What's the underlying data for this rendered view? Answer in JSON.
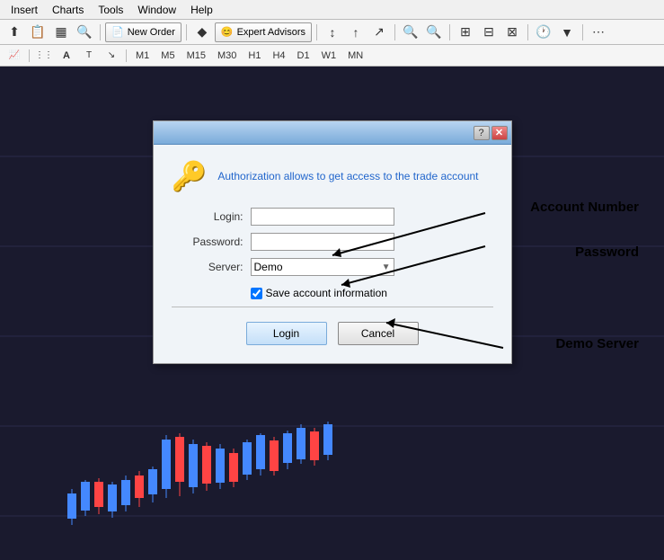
{
  "menubar": {
    "items": [
      "Insert",
      "Charts",
      "Tools",
      "Window",
      "Help"
    ]
  },
  "toolbar": {
    "new_order_label": "New Order",
    "expert_advisors_label": "Expert Advisors"
  },
  "timeframes": {
    "buttons": [
      "M1",
      "M5",
      "M15",
      "M30",
      "H1",
      "H4",
      "D1",
      "W1",
      "MN"
    ]
  },
  "dialog": {
    "title": "",
    "help_btn": "?",
    "close_btn": "✕",
    "description": "Authorization allows to get access to the trade account",
    "login_label": "Login:",
    "password_label": "Password:",
    "server_label": "Server:",
    "server_value": "Demo",
    "save_info_label": "Save account information",
    "login_btn": "Login",
    "cancel_btn": "Cancel"
  },
  "annotations": {
    "account_number": "Account Number",
    "password": "Password",
    "demo_server": "Demo Server"
  }
}
